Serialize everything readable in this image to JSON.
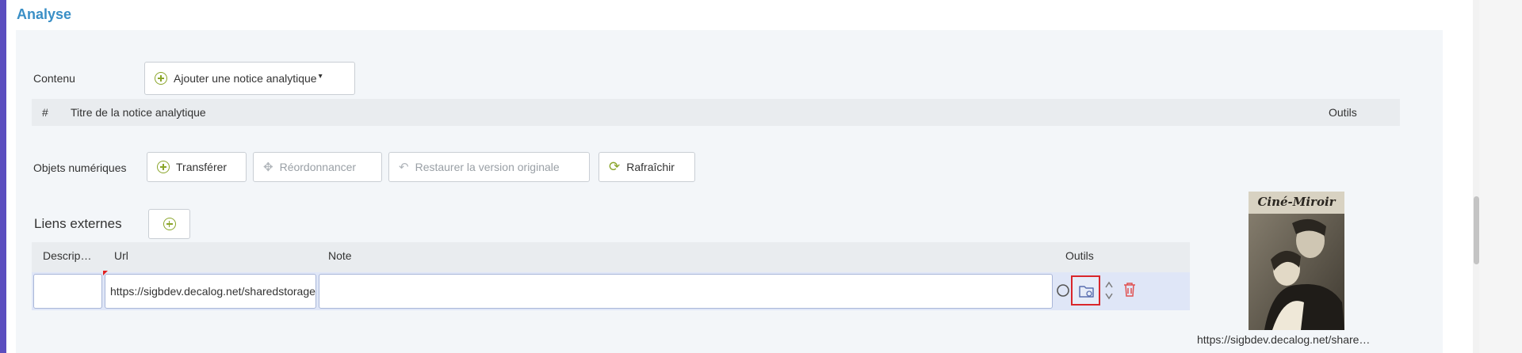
{
  "section": {
    "title": "Analyse"
  },
  "contenu": {
    "label": "Contenu",
    "add_button": "Ajouter une notice analytique",
    "table": {
      "col_index": "#",
      "col_title": "Titre de la notice analytique",
      "col_tools": "Outils"
    }
  },
  "objets": {
    "label": "Objets numériques",
    "buttons": {
      "transfer": "Transférer",
      "reorder": "Réordonnancer",
      "restore": "Restaurer la version originale",
      "refresh": "Rafraîchir"
    }
  },
  "liens": {
    "label": "Liens externes",
    "table": {
      "col_description": "Descrip…",
      "col_url": "Url",
      "col_note": "Note",
      "col_tools": "Outils"
    },
    "rows": [
      {
        "description": "",
        "url": "https://sigbdev.decalog.net/sharedstorage",
        "note": ""
      }
    ]
  },
  "preview": {
    "magazine_title": "Ciné-Miroir",
    "caption": "https://sigbdev.decalog.net/share…"
  },
  "colors": {
    "accent": "#5b4ebf",
    "title": "#3a8fc6",
    "plus": "#8aa52a",
    "delete": "#e05050",
    "highlight": "#d9262b"
  }
}
